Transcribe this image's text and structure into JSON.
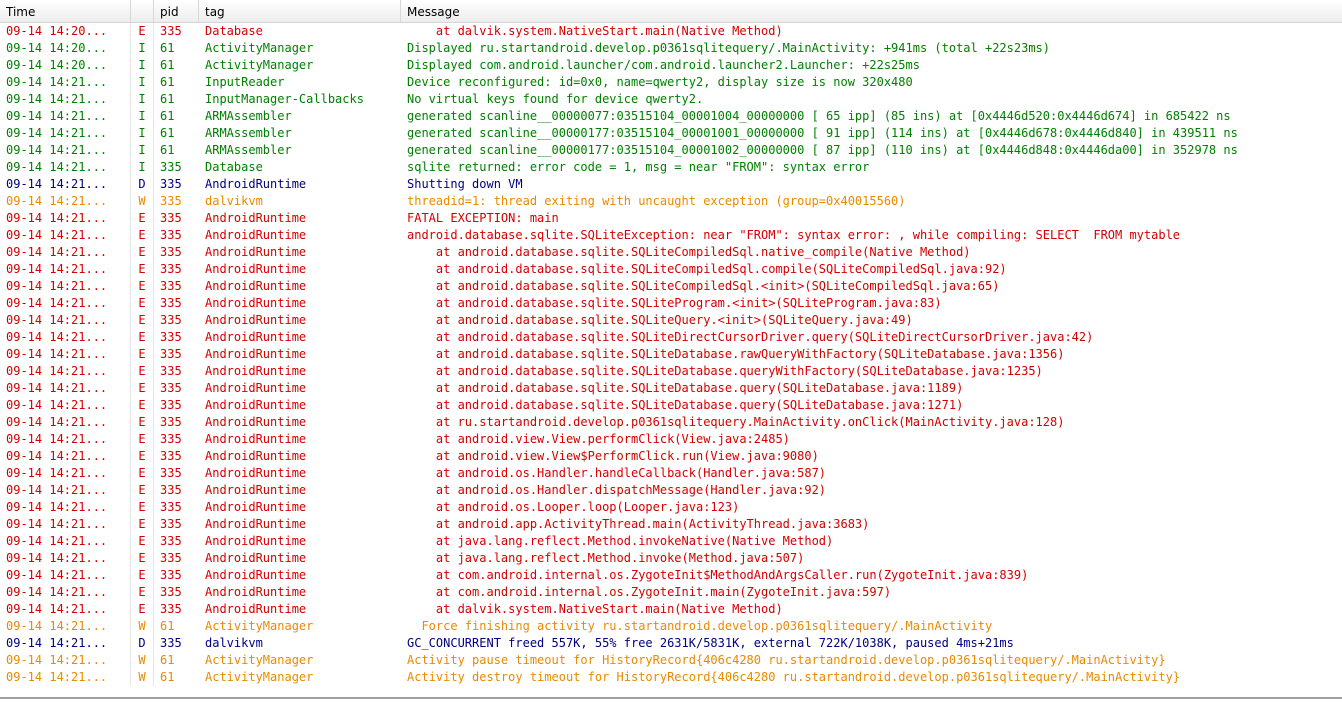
{
  "columns": {
    "time": "Time",
    "level": "",
    "pid": "pid",
    "tag": "tag",
    "message": "Message"
  },
  "level_colors": {
    "E": "#d40000",
    "I": "#007f00",
    "D": "#00007f",
    "W": "#e98a00"
  },
  "rows": [
    {
      "time": "09-14 14:20...",
      "level": "E",
      "pid": "335",
      "tag": "Database",
      "message": "    at dalvik.system.NativeStart.main(Native Method)"
    },
    {
      "time": "09-14 14:20...",
      "level": "I",
      "pid": "61",
      "tag": "ActivityManager",
      "message": "Displayed ru.startandroid.develop.p0361sqlitequery/.MainActivity: +941ms (total +22s23ms)"
    },
    {
      "time": "09-14 14:20...",
      "level": "I",
      "pid": "61",
      "tag": "ActivityManager",
      "message": "Displayed com.android.launcher/com.android.launcher2.Launcher: +22s25ms"
    },
    {
      "time": "09-14 14:21...",
      "level": "I",
      "pid": "61",
      "tag": "InputReader",
      "message": "Device reconfigured: id=0x0, name=qwerty2, display size is now 320x480"
    },
    {
      "time": "09-14 14:21...",
      "level": "I",
      "pid": "61",
      "tag": "InputManager-Callbacks",
      "message": "No virtual keys found for device qwerty2."
    },
    {
      "time": "09-14 14:21...",
      "level": "I",
      "pid": "61",
      "tag": "ARMAssembler",
      "message": "generated scanline__00000077:03515104_00001004_00000000 [ 65 ipp] (85 ins) at [0x4446d520:0x4446d674] in 685422 ns"
    },
    {
      "time": "09-14 14:21...",
      "level": "I",
      "pid": "61",
      "tag": "ARMAssembler",
      "message": "generated scanline__00000177:03515104_00001001_00000000 [ 91 ipp] (114 ins) at [0x4446d678:0x4446d840] in 439511 ns"
    },
    {
      "time": "09-14 14:21...",
      "level": "I",
      "pid": "61",
      "tag": "ARMAssembler",
      "message": "generated scanline__00000177:03515104_00001002_00000000 [ 87 ipp] (110 ins) at [0x4446d848:0x4446da00] in 352978 ns"
    },
    {
      "time": "09-14 14:21...",
      "level": "I",
      "pid": "335",
      "tag": "Database",
      "message": "sqlite returned: error code = 1, msg = near \"FROM\": syntax error"
    },
    {
      "time": "09-14 14:21...",
      "level": "D",
      "pid": "335",
      "tag": "AndroidRuntime",
      "message": "Shutting down VM"
    },
    {
      "time": "09-14 14:21...",
      "level": "W",
      "pid": "335",
      "tag": "dalvikvm",
      "message": "threadid=1: thread exiting with uncaught exception (group=0x40015560)"
    },
    {
      "time": "09-14 14:21...",
      "level": "E",
      "pid": "335",
      "tag": "AndroidRuntime",
      "message": "FATAL EXCEPTION: main"
    },
    {
      "time": "09-14 14:21...",
      "level": "E",
      "pid": "335",
      "tag": "AndroidRuntime",
      "message": "android.database.sqlite.SQLiteException: near \"FROM\": syntax error: , while compiling: SELECT  FROM mytable"
    },
    {
      "time": "09-14 14:21...",
      "level": "E",
      "pid": "335",
      "tag": "AndroidRuntime",
      "message": "    at android.database.sqlite.SQLiteCompiledSql.native_compile(Native Method)"
    },
    {
      "time": "09-14 14:21...",
      "level": "E",
      "pid": "335",
      "tag": "AndroidRuntime",
      "message": "    at android.database.sqlite.SQLiteCompiledSql.compile(SQLiteCompiledSql.java:92)"
    },
    {
      "time": "09-14 14:21...",
      "level": "E",
      "pid": "335",
      "tag": "AndroidRuntime",
      "message": "    at android.database.sqlite.SQLiteCompiledSql.<init>(SQLiteCompiledSql.java:65)"
    },
    {
      "time": "09-14 14:21...",
      "level": "E",
      "pid": "335",
      "tag": "AndroidRuntime",
      "message": "    at android.database.sqlite.SQLiteProgram.<init>(SQLiteProgram.java:83)"
    },
    {
      "time": "09-14 14:21...",
      "level": "E",
      "pid": "335",
      "tag": "AndroidRuntime",
      "message": "    at android.database.sqlite.SQLiteQuery.<init>(SQLiteQuery.java:49)"
    },
    {
      "time": "09-14 14:21...",
      "level": "E",
      "pid": "335",
      "tag": "AndroidRuntime",
      "message": "    at android.database.sqlite.SQLiteDirectCursorDriver.query(SQLiteDirectCursorDriver.java:42)"
    },
    {
      "time": "09-14 14:21...",
      "level": "E",
      "pid": "335",
      "tag": "AndroidRuntime",
      "message": "    at android.database.sqlite.SQLiteDatabase.rawQueryWithFactory(SQLiteDatabase.java:1356)"
    },
    {
      "time": "09-14 14:21...",
      "level": "E",
      "pid": "335",
      "tag": "AndroidRuntime",
      "message": "    at android.database.sqlite.SQLiteDatabase.queryWithFactory(SQLiteDatabase.java:1235)"
    },
    {
      "time": "09-14 14:21...",
      "level": "E",
      "pid": "335",
      "tag": "AndroidRuntime",
      "message": "    at android.database.sqlite.SQLiteDatabase.query(SQLiteDatabase.java:1189)"
    },
    {
      "time": "09-14 14:21...",
      "level": "E",
      "pid": "335",
      "tag": "AndroidRuntime",
      "message": "    at android.database.sqlite.SQLiteDatabase.query(SQLiteDatabase.java:1271)"
    },
    {
      "time": "09-14 14:21...",
      "level": "E",
      "pid": "335",
      "tag": "AndroidRuntime",
      "message": "    at ru.startandroid.develop.p0361sqlitequery.MainActivity.onClick(MainActivity.java:128)"
    },
    {
      "time": "09-14 14:21...",
      "level": "E",
      "pid": "335",
      "tag": "AndroidRuntime",
      "message": "    at android.view.View.performClick(View.java:2485)"
    },
    {
      "time": "09-14 14:21...",
      "level": "E",
      "pid": "335",
      "tag": "AndroidRuntime",
      "message": "    at android.view.View$PerformClick.run(View.java:9080)"
    },
    {
      "time": "09-14 14:21...",
      "level": "E",
      "pid": "335",
      "tag": "AndroidRuntime",
      "message": "    at android.os.Handler.handleCallback(Handler.java:587)"
    },
    {
      "time": "09-14 14:21...",
      "level": "E",
      "pid": "335",
      "tag": "AndroidRuntime",
      "message": "    at android.os.Handler.dispatchMessage(Handler.java:92)"
    },
    {
      "time": "09-14 14:21...",
      "level": "E",
      "pid": "335",
      "tag": "AndroidRuntime",
      "message": "    at android.os.Looper.loop(Looper.java:123)"
    },
    {
      "time": "09-14 14:21...",
      "level": "E",
      "pid": "335",
      "tag": "AndroidRuntime",
      "message": "    at android.app.ActivityThread.main(ActivityThread.java:3683)"
    },
    {
      "time": "09-14 14:21...",
      "level": "E",
      "pid": "335",
      "tag": "AndroidRuntime",
      "message": "    at java.lang.reflect.Method.invokeNative(Native Method)"
    },
    {
      "time": "09-14 14:21...",
      "level": "E",
      "pid": "335",
      "tag": "AndroidRuntime",
      "message": "    at java.lang.reflect.Method.invoke(Method.java:507)"
    },
    {
      "time": "09-14 14:21...",
      "level": "E",
      "pid": "335",
      "tag": "AndroidRuntime",
      "message": "    at com.android.internal.os.ZygoteInit$MethodAndArgsCaller.run(ZygoteInit.java:839)"
    },
    {
      "time": "09-14 14:21...",
      "level": "E",
      "pid": "335",
      "tag": "AndroidRuntime",
      "message": "    at com.android.internal.os.ZygoteInit.main(ZygoteInit.java:597)"
    },
    {
      "time": "09-14 14:21...",
      "level": "E",
      "pid": "335",
      "tag": "AndroidRuntime",
      "message": "    at dalvik.system.NativeStart.main(Native Method)"
    },
    {
      "time": "09-14 14:21...",
      "level": "W",
      "pid": "61",
      "tag": "ActivityManager",
      "message": "  Force finishing activity ru.startandroid.develop.p0361sqlitequery/.MainActivity"
    },
    {
      "time": "09-14 14:21...",
      "level": "D",
      "pid": "335",
      "tag": "dalvikvm",
      "message": "GC_CONCURRENT freed 557K, 55% free 2631K/5831K, external 722K/1038K, paused 4ms+21ms"
    },
    {
      "time": "09-14 14:21...",
      "level": "W",
      "pid": "61",
      "tag": "ActivityManager",
      "message": "Activity pause timeout for HistoryRecord{406c4280 ru.startandroid.develop.p0361sqlitequery/.MainActivity}"
    },
    {
      "time": "09-14 14:21...",
      "level": "W",
      "pid": "61",
      "tag": "ActivityManager",
      "message": "Activity destroy timeout for HistoryRecord{406c4280 ru.startandroid.develop.p0361sqlitequery/.MainActivity}"
    }
  ]
}
